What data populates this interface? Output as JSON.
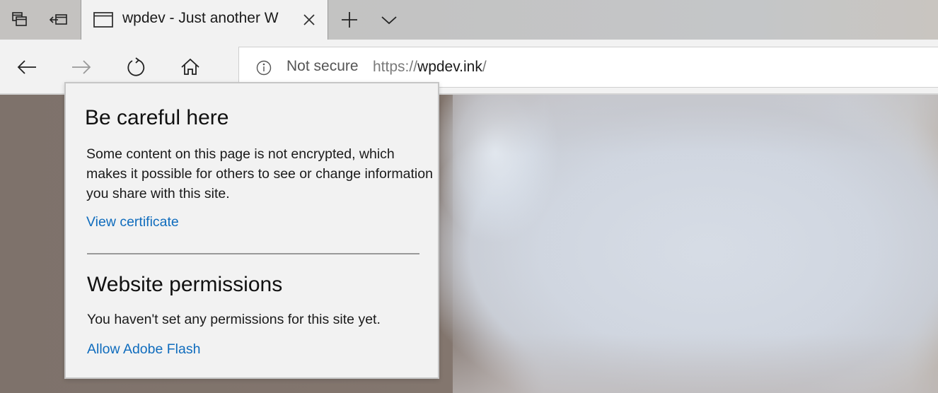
{
  "browser": {
    "tabbar": {
      "icons": [
        "set-aside-tabs-icon",
        "restore-tabs-icon"
      ],
      "active_tab": {
        "title": "wpdev - Just another W",
        "favicon": "page-icon",
        "close_icon": "close-icon"
      },
      "new_tab_icon": "plus-icon",
      "tab_preview_icon": "chevron-down-icon"
    },
    "navbar": {
      "back_icon": "arrow-left-icon",
      "forward_icon": "arrow-right-icon",
      "refresh_icon": "refresh-icon",
      "home_icon": "home-icon",
      "address": {
        "info_icon": "info-icon",
        "security_label": "Not secure",
        "url_scheme": "https://",
        "url_host": "wpdev.ink",
        "url_path": "/"
      }
    }
  },
  "popup": {
    "title": "Be careful here",
    "description": "Some content on this page is not encrypted, which makes it possible for others to see or change information you share with this site.",
    "view_certificate_link": "View certificate",
    "permissions_title": "Website permissions",
    "permissions_description": "You haven't set any permissions for this site yet.",
    "allow_flash_link": "Allow Adobe Flash"
  },
  "colors": {
    "link": "#0f6cbd",
    "chrome_bg": "#f2f2f2",
    "tabbar_bg": "#c3c3c3"
  }
}
